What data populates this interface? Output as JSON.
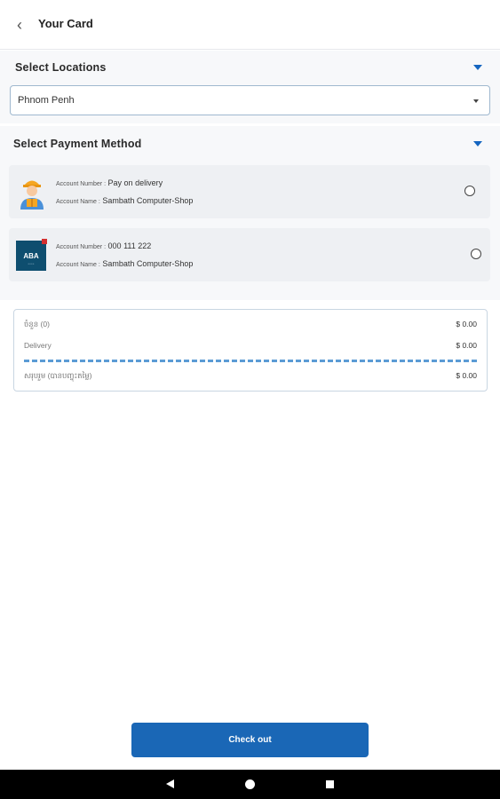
{
  "appbar": {
    "back_glyph": "‹",
    "title": "Your Card"
  },
  "locations": {
    "title": "Select Locations",
    "selected_value": "Phnom Penh"
  },
  "payment": {
    "title": "Select Payment Method",
    "methods": [
      {
        "icon": "delivery-person-icon",
        "account_number_label": "Account Number :",
        "account_number": "Pay on delivery",
        "account_name_label": "Account Name :",
        "account_name": "Sambath Computer-Shop"
      },
      {
        "icon": "aba-bank-logo",
        "logo_text": "ABA",
        "account_number_label": "Account Number :",
        "account_number": "000 111 222",
        "account_name_label": "Account Name :",
        "account_name": "Sambath Computer-Shop"
      }
    ]
  },
  "summary": {
    "subtotal_label": "ចំនួន (0)",
    "subtotal_value": "$ 0.00",
    "delivery_label": "Delivery",
    "delivery_value": "$ 0.00",
    "total_label": "សរុបរួម (បានបញ្ចុះតម្លៃ)",
    "total_value": "$ 0.00"
  },
  "checkout": {
    "label": "Check out"
  },
  "colors": {
    "accent": "#1a67b6",
    "dashed_divider": "#5b9bd5",
    "aba_blue": "#0e4e6f"
  }
}
